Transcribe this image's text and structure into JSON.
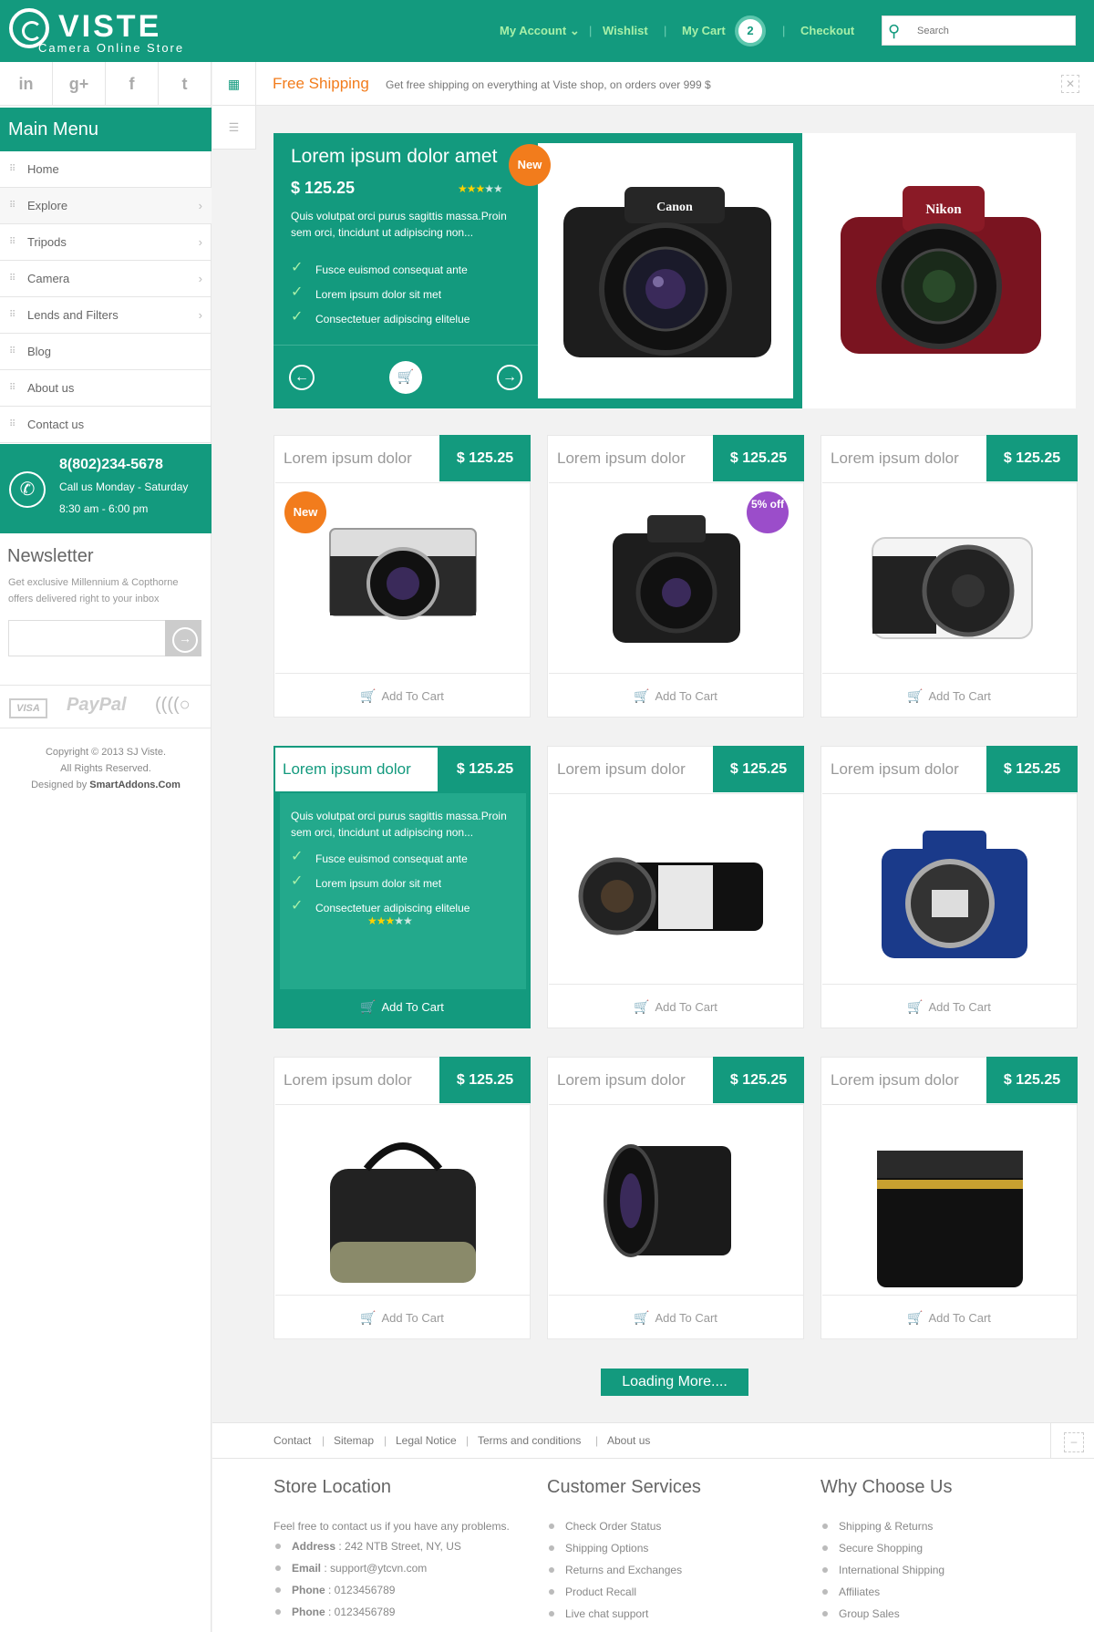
{
  "brand": {
    "name": "VISTE",
    "tagline": "Camera Online Store"
  },
  "topnav": {
    "my_account": "My Account",
    "wishlist": "Wishlist",
    "my_cart": "My Cart",
    "cart_count": "2",
    "checkout": "Checkout",
    "search_placeholder": "Search"
  },
  "social": [
    "in",
    "g+",
    "f",
    "t"
  ],
  "shipping": {
    "title": "Free Shipping",
    "text": "Get free shipping on everything at Viste shop, on orders over 999 $"
  },
  "menu": {
    "title": "Main Menu",
    "items": [
      {
        "label": "Home",
        "has_submenu": false
      },
      {
        "label": "Explore",
        "has_submenu": true
      },
      {
        "label": "Tripods",
        "has_submenu": true
      },
      {
        "label": "Camera",
        "has_submenu": true
      },
      {
        "label": "Lends and Filters",
        "has_submenu": true
      },
      {
        "label": "Blog",
        "has_submenu": false
      },
      {
        "label": "About us",
        "has_submenu": false
      },
      {
        "label": "Contact us",
        "has_submenu": false
      }
    ]
  },
  "contact": {
    "phone": "8(802)234-5678",
    "line1": "Call us Monday - Saturday",
    "line2": "8:30 am - 6:00 pm"
  },
  "newsletter": {
    "title": "Newsletter",
    "desc": "Get exclusive Millennium & Copthorne offers delivered right to your inbox"
  },
  "payments": {
    "visa": "VISA",
    "paypal": "PayPal"
  },
  "copyright": {
    "line1": "Copyright © 2013 SJ Viste.",
    "line2": "All Rights Reserved.",
    "line3_prefix": "Designed by ",
    "line3_brand": "SmartAddons.Com"
  },
  "featured": {
    "title": "Lorem ipsum dolor amet",
    "price": "$ 125.25",
    "rating": 3,
    "desc": "Quis volutpat orci purus sagittis massa.Proin sem orci, tincidunt ut adipiscing non...",
    "features": [
      "Fusce euismod consequat ante",
      "Lorem ipsum dolor sit met",
      "Consectetuer adipiscing elitelue"
    ],
    "badge": "New",
    "camera1_brand": "Canon",
    "camera2_brand": "Nikon"
  },
  "products": [
    {
      "title": "Lorem ipsum dolor",
      "price": "$ 125.25",
      "cart": "Add To Cart",
      "badge": "New",
      "image": "leica-camera"
    },
    {
      "title": "Lorem ipsum dolor",
      "price": "$ 125.25",
      "cart": "Add To Cart",
      "badge": "5% off",
      "image": "nikon-dslr"
    },
    {
      "title": "Lorem ipsum dolor",
      "price": "$ 125.25",
      "cart": "Add To Cart",
      "badge": "",
      "image": "pentax-white"
    },
    {
      "title": "Lorem ipsum dolor",
      "price": "$ 125.25",
      "cart": "Add To Cart",
      "badge": "",
      "image": "highlighted",
      "desc": "Quis volutpat orci purus sagittis massa.Proin sem orci, tincidunt ut adipiscing non...",
      "features": [
        "Fusce euismod consequat ante",
        "Lorem ipsum dolor sit met",
        "Consectetuer adipiscing elitelue"
      ],
      "rating": 3
    },
    {
      "title": "Lorem ipsum dolor",
      "price": "$ 125.25",
      "cart": "Add To Cart",
      "badge": "",
      "image": "jvc-camcorder"
    },
    {
      "title": "Lorem ipsum dolor",
      "price": "$ 125.25",
      "cart": "Add To Cart",
      "badge": "",
      "image": "pentax-blue"
    },
    {
      "title": "Lorem ipsum dolor",
      "price": "$ 125.25",
      "cart": "Add To Cart",
      "badge": "",
      "image": "canon-bag"
    },
    {
      "title": "Lorem ipsum dolor",
      "price": "$ 125.25",
      "cart": "Add To Cart",
      "badge": "",
      "image": "lens-black"
    },
    {
      "title": "Lorem ipsum dolor",
      "price": "$ 125.25",
      "cart": "Add To Cart",
      "badge": "",
      "image": "lens-50mm"
    }
  ],
  "load_more": "Loading More....",
  "footer": {
    "links": [
      "Contact",
      "Sitemap",
      "Legal Notice",
      "Terms and conditions",
      "About us"
    ],
    "store": {
      "title": "Store Location",
      "desc": "Feel free to contact us if you have any problems.",
      "items": [
        [
          "Address",
          " : 242 NTB Street, NY, US"
        ],
        [
          "Email",
          " : support@ytcvn.com"
        ],
        [
          "Phone",
          " : 0123456789"
        ],
        [
          "Phone",
          " : 0123456789"
        ]
      ]
    },
    "services": {
      "title": "Customer Services",
      "items": [
        "Check Order Status",
        "Shipping Options",
        "Returns and Exchanges",
        "Product Recall",
        "Live chat support"
      ]
    },
    "why": {
      "title": "Why Choose Us",
      "items": [
        "Shipping & Returns",
        "Secure Shopping",
        "International Shipping",
        "Affiliates",
        "Group Sales"
      ]
    }
  },
  "colors": {
    "brand": "#139a7e",
    "accent_orange": "#f27c1c",
    "badge_purple": "#9b4dca",
    "star": "#ffd200"
  }
}
